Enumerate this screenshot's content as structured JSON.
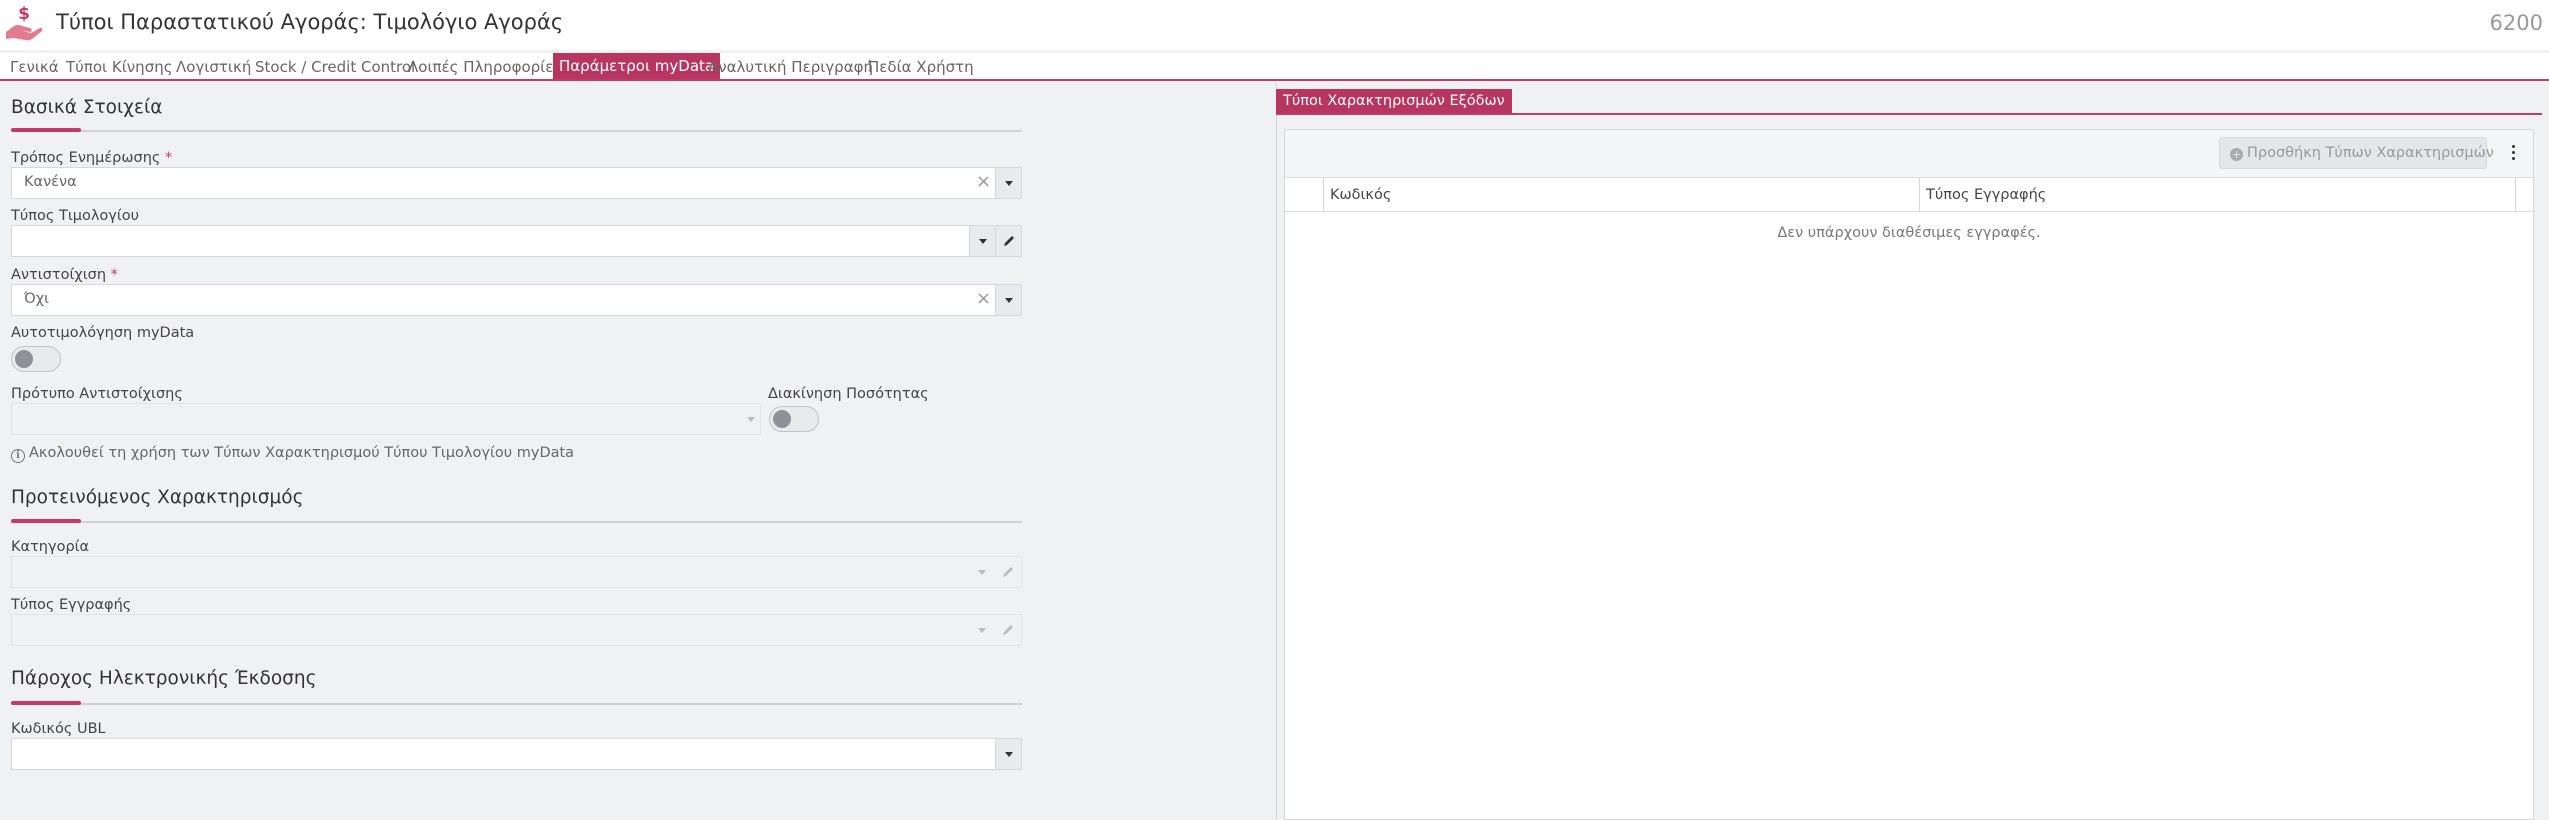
{
  "header": {
    "title": "Τύποι Παραστατικού Αγοράς: Τιμολόγιο Αγοράς",
    "record_number": "6200",
    "icon": "hand-dollar-icon"
  },
  "tabs": [
    {
      "label": "Γενικά",
      "active": false
    },
    {
      "label": "Τύποι Κίνησης",
      "active": false
    },
    {
      "label": "Λογιστική",
      "active": false
    },
    {
      "label": "Stock / Credit Control",
      "active": false
    },
    {
      "label": "Λοιπές Πληροφορίες",
      "active": false
    },
    {
      "label": "Παράμετροι myData",
      "active": true
    },
    {
      "label": "Αναλυτική Περιγραφή",
      "active": false
    },
    {
      "label": "Πεδία Χρήστη",
      "active": false
    }
  ],
  "basic": {
    "title": "Βασικά Στοιχεία",
    "update_mode": {
      "label": "Τρόπος Ενημέρωσης",
      "required": "*",
      "value": "Κανένα"
    },
    "invoice_type": {
      "label": "Τύπος Τιμολογίου",
      "value": ""
    },
    "mapping": {
      "label": "Αντιστοίχιση",
      "required": "*",
      "value": "Όχι"
    },
    "auto_invoicing": {
      "label": "Αυτοτιμολόγηση myData",
      "on": false
    },
    "mapping_template": {
      "label": "Πρότυπο Αντιστοίχισης",
      "value": ""
    },
    "qty_movement": {
      "label": "Διακίνηση Ποσότητας",
      "on": false
    },
    "note": "Ακολουθεί τη χρήση των Τύπων Χαρακτηρισμού Τύπου Τιμολογίου myData"
  },
  "suggested": {
    "title": "Προτεινόμενος Χαρακτηρισμός",
    "category": {
      "label": "Κατηγορία",
      "value": ""
    },
    "entry_type": {
      "label": "Τύπος Εγγραφής",
      "value": ""
    }
  },
  "provider": {
    "title": "Πάροχος Ηλεκτρονικής Έκδοσης",
    "ubl_code": {
      "label": "Κωδικός UBL",
      "value": ""
    }
  },
  "right_panel": {
    "tab_label": "Τύποι Χαρακτηρισμών Εξόδων",
    "add_button": "Προσθήκη Τύπων Χαρακτηρισμών",
    "columns": [
      "Κωδικός",
      "Τύπος Εγγραφής"
    ],
    "empty_message": "Δεν υπάρχουν διαθέσιμες εγγραφές."
  },
  "colors": {
    "accent": "#b7355f",
    "accent_line": "#c4396a",
    "background": "#f0f1f3"
  }
}
